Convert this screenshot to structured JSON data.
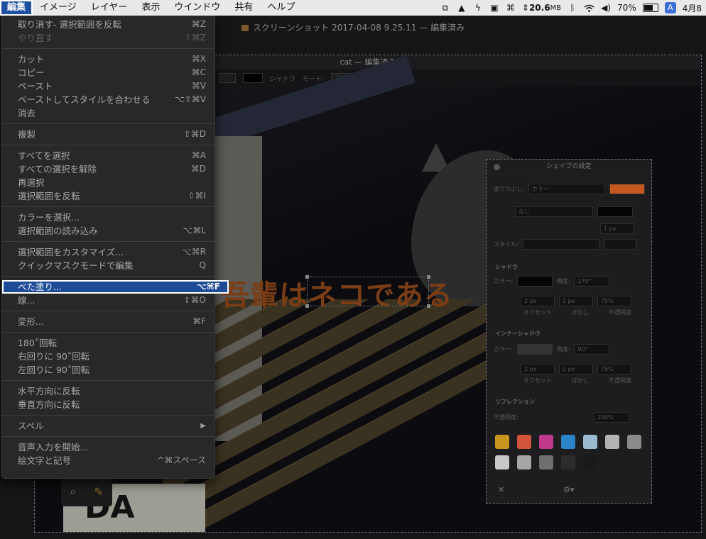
{
  "menubar": {
    "items": [
      "編集",
      "イメージ",
      "レイヤー",
      "表示",
      "ウインドウ",
      "共有",
      "ヘルプ"
    ],
    "active_index": 0,
    "status": {
      "network_speed": "20.6",
      "network_unit": "MB",
      "battery_percent": "70%",
      "battery_level": 0.7,
      "input_source": "A",
      "date": "4月8"
    }
  },
  "app": {
    "outer_window_title": "スクリーンショット 2017-04-08 9.25.11 — 編集済み",
    "inner_window_title": "cat — 編集済み",
    "toolbar": {
      "shadow_label": "シャドウ",
      "mode_label": "モード:",
      "shape_settings_button": "シェイプの設定"
    },
    "canvas_text": "吾輩はネコである",
    "sign_text": "DA"
  },
  "shape_panel": {
    "title": "シェイプの設定",
    "fill_label": "塗りつぶし:",
    "fill_value": "カラー",
    "fill_color": "#c4581f",
    "stroke_value": "なし",
    "width_value": "1 px",
    "style_label": "スタイル:",
    "shadow_heading": "シャドウ",
    "shadow_color_label": "カラー:",
    "shadow_angle_label": "角度:",
    "shadow_angle": "270°",
    "shadow_offset": "2 px",
    "shadow_blur": "2 px",
    "shadow_opacity": "75%",
    "offset_label": "オフセット",
    "blur_label": "ぼかし",
    "opacity_label": "不透明度",
    "inner_shadow_heading": "インナーシャドウ",
    "inner_angle": "90°",
    "inner_offset": "2 px",
    "inner_blur": "2 px",
    "inner_opacity": "75%",
    "reflection_heading": "リフレクション",
    "reflection_opacity_label": "不透明度:",
    "reflection_opacity": "100%",
    "swatch_colors": [
      "#c8951f",
      "#d2553b",
      "#c0398d",
      "#2a84c7",
      "#9bb9cf",
      "#b3b3b3",
      "#8a8a8a",
      "#c8c8c8",
      "#a6a6a6",
      "#6f6f6f",
      "#2c2c2c",
      "#1a1a1a"
    ]
  },
  "edit_menu": {
    "groups": [
      [
        {
          "label": "取り消す- 選択範囲を反転",
          "shortcut": "⌘Z",
          "enabled": true
        },
        {
          "label": "やり直す",
          "shortcut": "⇧⌘Z",
          "enabled": false
        }
      ],
      [
        {
          "label": "カット",
          "shortcut": "⌘X",
          "enabled": true
        },
        {
          "label": "コピー",
          "shortcut": "⌘C",
          "enabled": true
        },
        {
          "label": "ペースト",
          "shortcut": "⌘V",
          "enabled": true
        },
        {
          "label": "ペーストしてスタイルを合わせる",
          "shortcut": "⌥⇧⌘V",
          "enabled": true
        },
        {
          "label": "消去",
          "shortcut": "",
          "enabled": true
        }
      ],
      [
        {
          "label": "複製",
          "shortcut": "⇧⌘D",
          "enabled": true
        }
      ],
      [
        {
          "label": "すべてを選択",
          "shortcut": "⌘A",
          "enabled": true
        },
        {
          "label": "すべての選択を解除",
          "shortcut": "⌘D",
          "enabled": true
        },
        {
          "label": "再選択",
          "shortcut": "",
          "enabled": true
        },
        {
          "label": "選択範囲を反転",
          "shortcut": "⇧⌘I",
          "enabled": true
        }
      ],
      [
        {
          "label": "カラーを選択...",
          "shortcut": "",
          "enabled": true
        },
        {
          "label": "選択範囲の読み込み",
          "shortcut": "⌥⌘L",
          "enabled": true
        }
      ],
      [
        {
          "label": "選択範囲をカスタマイズ...",
          "shortcut": "⌥⌘R",
          "enabled": true
        },
        {
          "label": "クイックマスクモードで編集",
          "shortcut": "Q",
          "enabled": true
        }
      ],
      [
        {
          "label": "べた塗り...",
          "shortcut": "⌥⌘F",
          "enabled": true,
          "selected": true
        },
        {
          "label": "線...",
          "shortcut": "⇧⌘O",
          "enabled": true
        }
      ],
      [
        {
          "label": "変形...",
          "shortcut": "⌘F",
          "enabled": true
        }
      ],
      [
        {
          "label": "180˚回転",
          "shortcut": "",
          "enabled": true
        },
        {
          "label": "右回りに 90˚回転",
          "shortcut": "",
          "enabled": true
        },
        {
          "label": "左回りに 90˚回転",
          "shortcut": "",
          "enabled": true
        }
      ],
      [
        {
          "label": "水平方向に反転",
          "shortcut": "",
          "enabled": true
        },
        {
          "label": "垂直方向に反転",
          "shortcut": "",
          "enabled": true
        }
      ],
      [
        {
          "label": "スペル",
          "shortcut": "",
          "enabled": true,
          "submenu": true
        }
      ],
      [
        {
          "label": "音声入力を開始...",
          "shortcut": "",
          "enabled": true
        },
        {
          "label": "絵文字と記号",
          "shortcut": "^⌘スペース",
          "enabled": true
        }
      ]
    ]
  }
}
